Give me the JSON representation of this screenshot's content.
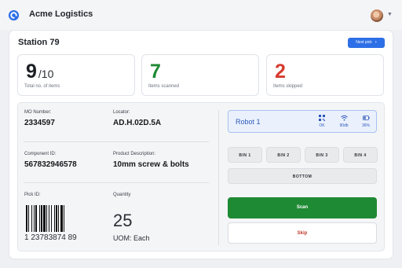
{
  "app": {
    "title": "Acme Logistics"
  },
  "station": {
    "title": "Station 79",
    "next_label": "Next pick"
  },
  "stats": {
    "total": {
      "value": "9",
      "denominator": "/10",
      "label": "Total no. of items"
    },
    "scanned": {
      "value": "7",
      "label": "Items scanned",
      "color": "#1f8a34"
    },
    "skipped": {
      "value": "2",
      "label": "Items skipped",
      "color": "#d63b2f"
    }
  },
  "details": {
    "mo": {
      "label": "MO Number:",
      "value": "2334597"
    },
    "locator": {
      "label": "Locator:",
      "value": "AD.H.02D.5A"
    },
    "component": {
      "label": "Component ID:",
      "value": "567832946578"
    },
    "description": {
      "label": "Product Description:",
      "value": "10mm screw & bolts"
    },
    "pick": {
      "label": "Pick ID:",
      "barcode_text": "1 23783874 89"
    },
    "quantity": {
      "label": "Quantity",
      "value": "25",
      "uom": "UOM: Each"
    }
  },
  "robot": {
    "name": "Robot 1",
    "status": [
      {
        "icon": "qr-code-icon",
        "label": "OK"
      },
      {
        "icon": "wifi-icon",
        "label": "90db"
      },
      {
        "icon": "battery-icon",
        "label": "36%"
      }
    ]
  },
  "bins": [
    "BIN 1",
    "BIN 2",
    "BIN 3",
    "BIN 4"
  ],
  "bottom_label": "BOTTOM",
  "actions": {
    "scan": "Scan",
    "skip": "Skip"
  },
  "colors": {
    "accent": "#2d6fe6",
    "success": "#1f8a34",
    "danger": "#d63b2f"
  }
}
